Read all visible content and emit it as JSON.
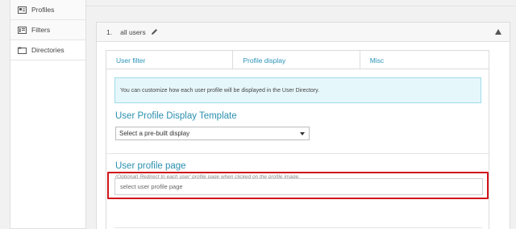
{
  "sidebar": {
    "items": [
      {
        "label": "Profiles",
        "icon": "id-card-icon"
      },
      {
        "label": "Filters",
        "icon": "filter-icon"
      },
      {
        "label": "Directories",
        "icon": "folder-icon"
      }
    ]
  },
  "group": {
    "number": "1.",
    "title": "all users"
  },
  "tabs": [
    {
      "label": "User filter"
    },
    {
      "label": "Profile display"
    },
    {
      "label": "Misc"
    }
  ],
  "panel": {
    "notice": "You can customize how each user profile will be displayed in the User Directory.",
    "display_template_title": "User Profile Display Template",
    "display_select_value": "Select a pre-built display",
    "profile_page_title": "User profile page",
    "profile_page_hint": "(Optional) Redirect to each user' profile page when clicked on the profile image.",
    "profile_page_placeholder": "select user profile page"
  },
  "colors": {
    "accent": "#2a93b8",
    "highlight": "#d0151a",
    "notice_bg": "#e6f7fb"
  }
}
